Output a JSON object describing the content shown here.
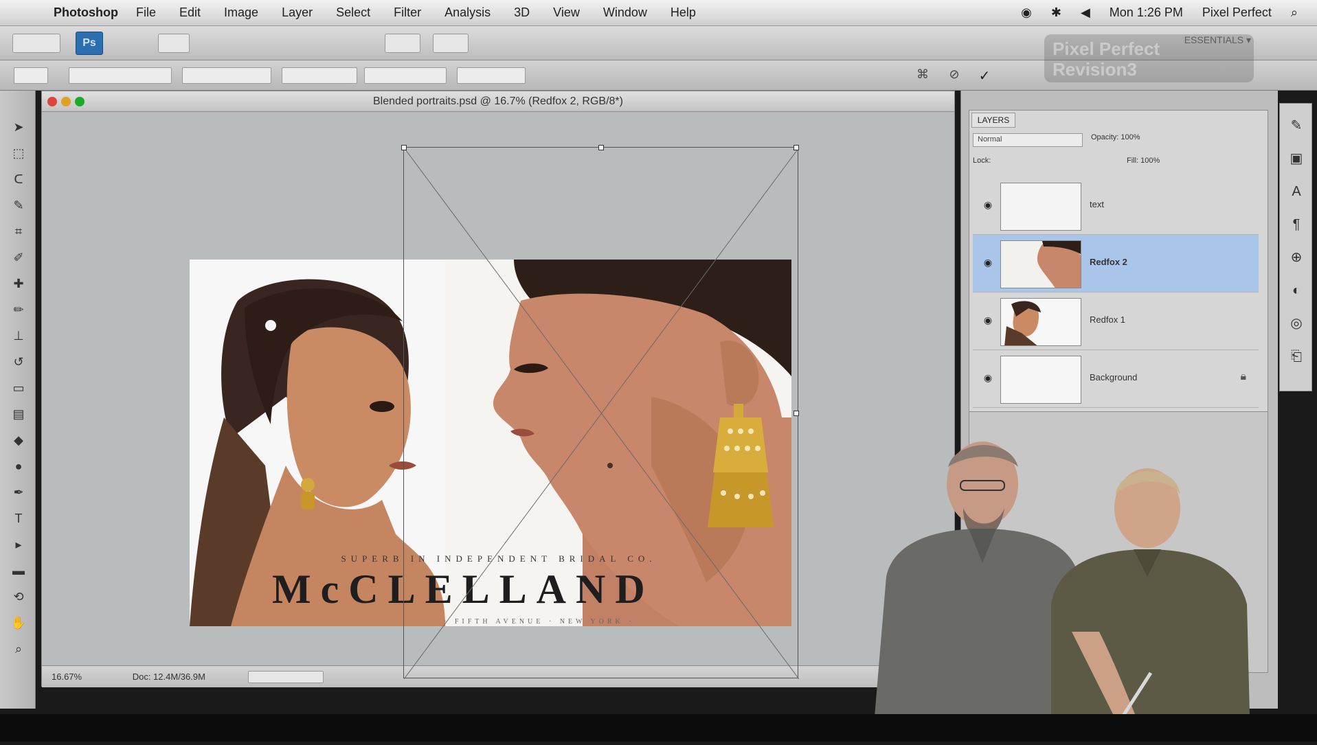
{
  "menubar": {
    "app_name": "Photoshop",
    "items": [
      "File",
      "Edit",
      "Image",
      "Layer",
      "Select",
      "Filter",
      "Analysis",
      "3D",
      "View",
      "Window",
      "Help"
    ],
    "clock": "Mon 1:26 PM",
    "user": "Pixel Perfect"
  },
  "appbar": {
    "ps_label": "Ps",
    "workspace": "ESSENTIALS ▾"
  },
  "document": {
    "title": "Blended portraits.psd @ 16.7% (Redfox 2, RGB/8*)",
    "zoom": "16.67%",
    "doc_info": "Doc: 12.4M/36.9M"
  },
  "artwork": {
    "tagline": "SUPERB IN INDEPENDENT BRIDAL CO.",
    "brand": "McCLELLAND",
    "address": "· FIFTH AVENUE · NEW YORK ·"
  },
  "layers_panel": {
    "tab": "LAYERS",
    "blend_mode": "Normal",
    "opacity_label": "Opacity: 100%",
    "lock_label": "Lock:",
    "fill_label": "Fill: 100%",
    "rows": [
      {
        "name": "text",
        "selected": false
      },
      {
        "name": "Redfox 2",
        "selected": true
      },
      {
        "name": "Redfox 1",
        "selected": false
      },
      {
        "name": "Background",
        "selected": false
      }
    ]
  },
  "watermark": {
    "line1": "Pixel Perfect",
    "line2": "Revision3"
  },
  "colors": {
    "selected_layer": "#a9c6ea",
    "canvas_bg": "#b9bcbc",
    "ps_blue": "#2b6fb0"
  }
}
